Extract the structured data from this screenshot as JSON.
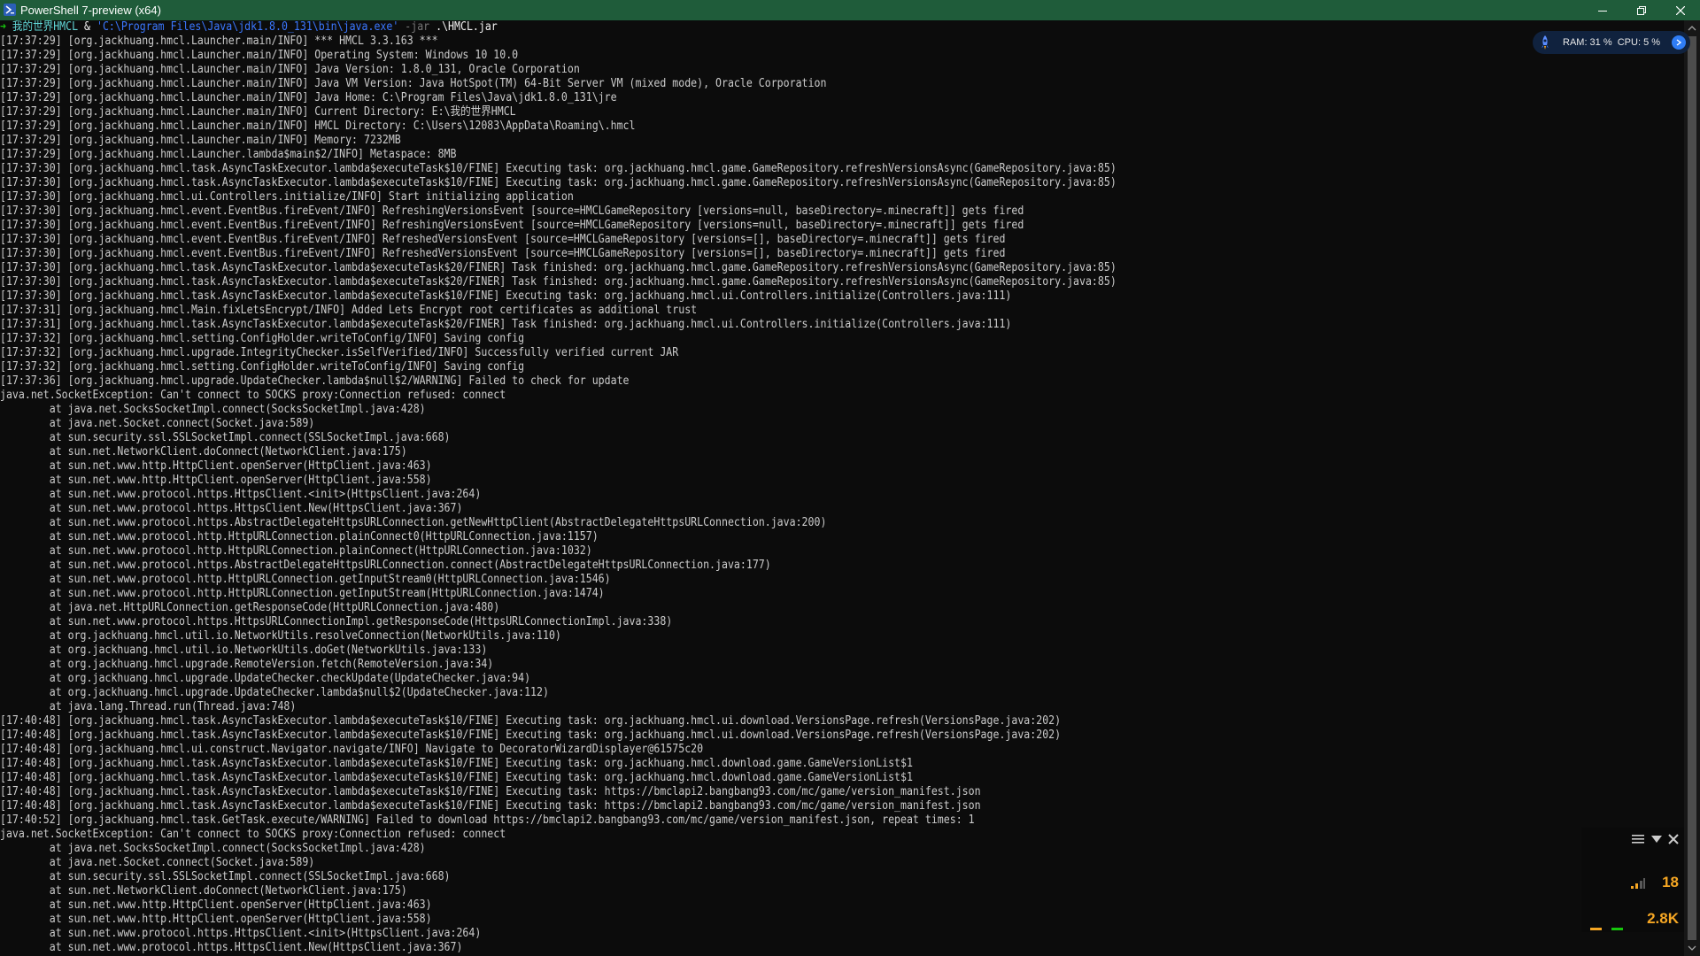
{
  "window": {
    "title": "PowerShell 7-preview (x64)"
  },
  "prompt": {
    "path": "我的世界HMCL",
    "operator": "&",
    "exe": "'C:\\Program Files\\Java\\jdk1.8.0_131\\bin\\java.exe'",
    "param": "-jar",
    "arg": ".\\HMCL.jar"
  },
  "console": {
    "lines": [
      "[17:37:29] [org.jackhuang.hmcl.Launcher.main/INFO] *** HMCL 3.3.163 ***",
      "[17:37:29] [org.jackhuang.hmcl.Launcher.main/INFO] Operating System: Windows 10 10.0",
      "[17:37:29] [org.jackhuang.hmcl.Launcher.main/INFO] Java Version: 1.8.0_131, Oracle Corporation",
      "[17:37:29] [org.jackhuang.hmcl.Launcher.main/INFO] Java VM Version: Java HotSpot(TM) 64-Bit Server VM (mixed mode), Oracle Corporation",
      "[17:37:29] [org.jackhuang.hmcl.Launcher.main/INFO] Java Home: C:\\Program Files\\Java\\jdk1.8.0_131\\jre",
      "[17:37:29] [org.jackhuang.hmcl.Launcher.main/INFO] Current Directory: E:\\我的世界HMCL",
      "[17:37:29] [org.jackhuang.hmcl.Launcher.main/INFO] HMCL Directory: C:\\Users\\12083\\AppData\\Roaming\\.hmcl",
      "[17:37:29] [org.jackhuang.hmcl.Launcher.main/INFO] Memory: 7232MB",
      "[17:37:29] [org.jackhuang.hmcl.Launcher.lambda$main$2/INFO] Metaspace: 8MB",
      "[17:37:30] [org.jackhuang.hmcl.task.AsyncTaskExecutor.lambda$executeTask$10/FINE] Executing task: org.jackhuang.hmcl.game.GameRepository.refreshVersionsAsync(GameRepository.java:85)",
      "[17:37:30] [org.jackhuang.hmcl.task.AsyncTaskExecutor.lambda$executeTask$10/FINE] Executing task: org.jackhuang.hmcl.game.GameRepository.refreshVersionsAsync(GameRepository.java:85)",
      "[17:37:30] [org.jackhuang.hmcl.ui.Controllers.initialize/INFO] Start initializing application",
      "[17:37:30] [org.jackhuang.hmcl.event.EventBus.fireEvent/INFO] RefreshingVersionsEvent [source=HMCLGameRepository [versions=null, baseDirectory=.minecraft]] gets fired",
      "[17:37:30] [org.jackhuang.hmcl.event.EventBus.fireEvent/INFO] RefreshingVersionsEvent [source=HMCLGameRepository [versions=null, baseDirectory=.minecraft]] gets fired",
      "[17:37:30] [org.jackhuang.hmcl.event.EventBus.fireEvent/INFO] RefreshedVersionsEvent [source=HMCLGameRepository [versions=[], baseDirectory=.minecraft]] gets fired",
      "[17:37:30] [org.jackhuang.hmcl.event.EventBus.fireEvent/INFO] RefreshedVersionsEvent [source=HMCLGameRepository [versions=[], baseDirectory=.minecraft]] gets fired",
      "[17:37:30] [org.jackhuang.hmcl.task.AsyncTaskExecutor.lambda$executeTask$20/FINER] Task finished: org.jackhuang.hmcl.game.GameRepository.refreshVersionsAsync(GameRepository.java:85)",
      "[17:37:30] [org.jackhuang.hmcl.task.AsyncTaskExecutor.lambda$executeTask$20/FINER] Task finished: org.jackhuang.hmcl.game.GameRepository.refreshVersionsAsync(GameRepository.java:85)",
      "[17:37:30] [org.jackhuang.hmcl.task.AsyncTaskExecutor.lambda$executeTask$10/FINE] Executing task: org.jackhuang.hmcl.ui.Controllers.initialize(Controllers.java:111)",
      "[17:37:31] [org.jackhuang.hmcl.Main.fixLetsEncrypt/INFO] Added Lets Encrypt root certificates as additional trust",
      "[17:37:31] [org.jackhuang.hmcl.task.AsyncTaskExecutor.lambda$executeTask$20/FINER] Task finished: org.jackhuang.hmcl.ui.Controllers.initialize(Controllers.java:111)",
      "[17:37:32] [org.jackhuang.hmcl.setting.ConfigHolder.writeToConfig/INFO] Saving config",
      "[17:37:32] [org.jackhuang.hmcl.upgrade.IntegrityChecker.isSelfVerified/INFO] Successfully verified current JAR",
      "[17:37:32] [org.jackhuang.hmcl.setting.ConfigHolder.writeToConfig/INFO] Saving config",
      "[17:37:36] [org.jackhuang.hmcl.upgrade.UpdateChecker.lambda$null$2/WARNING] Failed to check for update",
      "java.net.SocketException: Can't connect to SOCKS proxy:Connection refused: connect",
      "        at java.net.SocksSocketImpl.connect(SocksSocketImpl.java:428)",
      "        at java.net.Socket.connect(Socket.java:589)",
      "        at sun.security.ssl.SSLSocketImpl.connect(SSLSocketImpl.java:668)",
      "        at sun.net.NetworkClient.doConnect(NetworkClient.java:175)",
      "        at sun.net.www.http.HttpClient.openServer(HttpClient.java:463)",
      "        at sun.net.www.http.HttpClient.openServer(HttpClient.java:558)",
      "        at sun.net.www.protocol.https.HttpsClient.<init>(HttpsClient.java:264)",
      "        at sun.net.www.protocol.https.HttpsClient.New(HttpsClient.java:367)",
      "        at sun.net.www.protocol.https.AbstractDelegateHttpsURLConnection.getNewHttpClient(AbstractDelegateHttpsURLConnection.java:200)",
      "        at sun.net.www.protocol.http.HttpURLConnection.plainConnect0(HttpURLConnection.java:1157)",
      "        at sun.net.www.protocol.http.HttpURLConnection.plainConnect(HttpURLConnection.java:1032)",
      "        at sun.net.www.protocol.https.AbstractDelegateHttpsURLConnection.connect(AbstractDelegateHttpsURLConnection.java:177)",
      "        at sun.net.www.protocol.http.HttpURLConnection.getInputStream0(HttpURLConnection.java:1546)",
      "        at sun.net.www.protocol.http.HttpURLConnection.getInputStream(HttpURLConnection.java:1474)",
      "        at java.net.HttpURLConnection.getResponseCode(HttpURLConnection.java:480)",
      "        at sun.net.www.protocol.https.HttpsURLConnectionImpl.getResponseCode(HttpsURLConnectionImpl.java:338)",
      "        at org.jackhuang.hmcl.util.io.NetworkUtils.resolveConnection(NetworkUtils.java:110)",
      "        at org.jackhuang.hmcl.util.io.NetworkUtils.doGet(NetworkUtils.java:133)",
      "        at org.jackhuang.hmcl.upgrade.RemoteVersion.fetch(RemoteVersion.java:34)",
      "        at org.jackhuang.hmcl.upgrade.UpdateChecker.checkUpdate(UpdateChecker.java:94)",
      "        at org.jackhuang.hmcl.upgrade.UpdateChecker.lambda$null$2(UpdateChecker.java:112)",
      "        at java.lang.Thread.run(Thread.java:748)",
      "[17:40:48] [org.jackhuang.hmcl.task.AsyncTaskExecutor.lambda$executeTask$10/FINE] Executing task: org.jackhuang.hmcl.ui.download.VersionsPage.refresh(VersionsPage.java:202)",
      "[17:40:48] [org.jackhuang.hmcl.task.AsyncTaskExecutor.lambda$executeTask$10/FINE] Executing task: org.jackhuang.hmcl.ui.download.VersionsPage.refresh(VersionsPage.java:202)",
      "[17:40:48] [org.jackhuang.hmcl.ui.construct.Navigator.navigate/INFO] Navigate to DecoratorWizardDisplayer@61575c20",
      "[17:40:48] [org.jackhuang.hmcl.task.AsyncTaskExecutor.lambda$executeTask$10/FINE] Executing task: org.jackhuang.hmcl.download.game.GameVersionList$1",
      "[17:40:48] [org.jackhuang.hmcl.task.AsyncTaskExecutor.lambda$executeTask$10/FINE] Executing task: org.jackhuang.hmcl.download.game.GameVersionList$1",
      "[17:40:48] [org.jackhuang.hmcl.task.AsyncTaskExecutor.lambda$executeTask$10/FINE] Executing task: https://bmclapi2.bangbang93.com/mc/game/version_manifest.json",
      "[17:40:48] [org.jackhuang.hmcl.task.AsyncTaskExecutor.lambda$executeTask$10/FINE] Executing task: https://bmclapi2.bangbang93.com/mc/game/version_manifest.json",
      "[17:40:52] [org.jackhuang.hmcl.task.GetTask.execute/WARNING] Failed to download https://bmclapi2.bangbang93.com/mc/game/version_manifest.json, repeat times: 1",
      "java.net.SocketException: Can't connect to SOCKS proxy:Connection refused: connect",
      "        at java.net.SocksSocketImpl.connect(SocksSocketImpl.java:428)",
      "        at java.net.Socket.connect(Socket.java:589)",
      "        at sun.security.ssl.SSLSocketImpl.connect(SSLSocketImpl.java:668)",
      "        at sun.net.NetworkClient.doConnect(NetworkClient.java:175)",
      "        at sun.net.www.http.HttpClient.openServer(HttpClient.java:463)",
      "        at sun.net.www.http.HttpClient.openServer(HttpClient.java:558)",
      "        at sun.net.www.protocol.https.HttpsClient.<init>(HttpsClient.java:264)",
      "        at sun.net.www.protocol.https.HttpsClient.New(HttpsClient.java:367)"
    ]
  },
  "sysmon": {
    "text": "RAM: 31 %  CPU: 5 %",
    "icon": "rocket-icon",
    "accent": "#2f7df6"
  },
  "netwidget": {
    "ping": "18",
    "speed": "2.8K",
    "value_color": "#f5a623"
  },
  "colors": {
    "titlebar": "#1f5c3a",
    "console_bg": "#0c0c0c",
    "console_text": "#cccccc",
    "prompt_arrow": "#16c60c",
    "prompt_path": "#61d6d6",
    "prompt_string": "#3b78ff"
  }
}
